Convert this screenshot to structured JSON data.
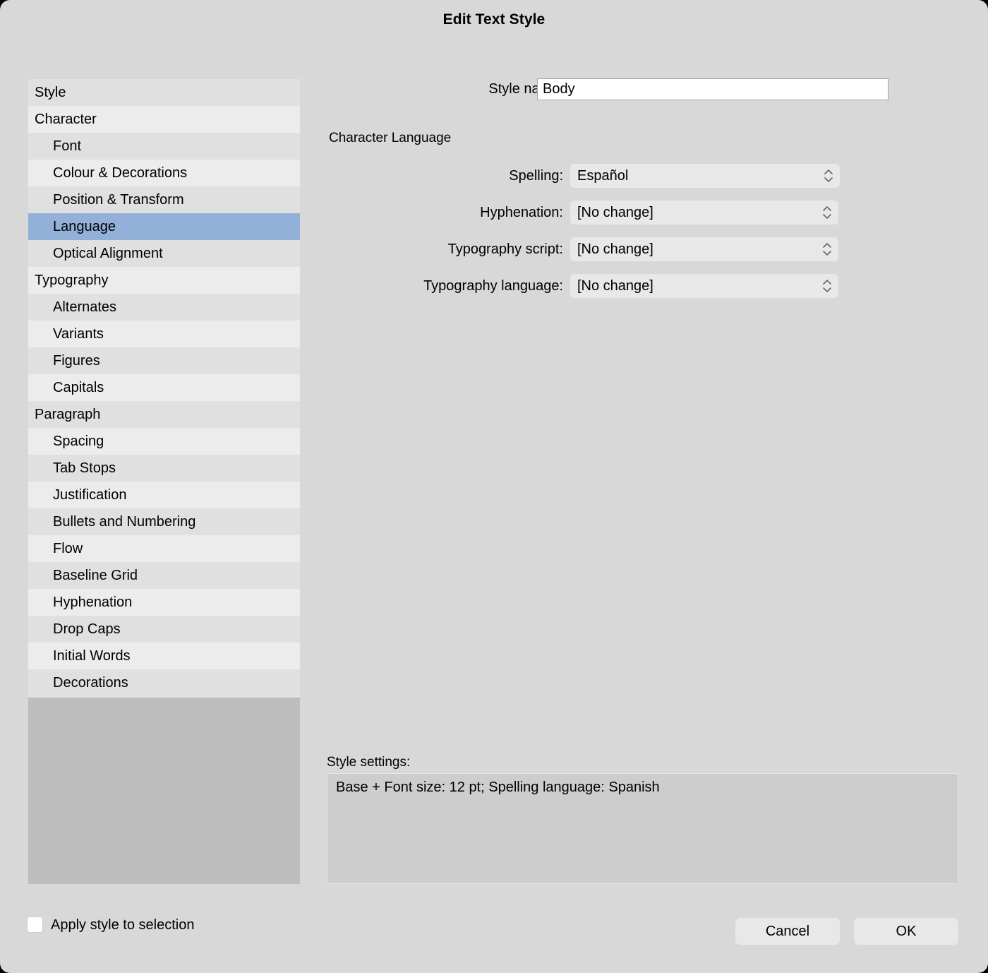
{
  "window": {
    "title": "Edit Text Style",
    "accent_selected": "#93b0d8",
    "background": "#d8d8d8"
  },
  "sidebar": {
    "items": [
      {
        "label": "Style",
        "level": "group",
        "selected": false
      },
      {
        "label": "Character",
        "level": "group",
        "selected": false
      },
      {
        "label": "Font",
        "level": "child",
        "selected": false
      },
      {
        "label": "Colour & Decorations",
        "level": "child",
        "selected": false
      },
      {
        "label": "Position & Transform",
        "level": "child",
        "selected": false
      },
      {
        "label": "Language",
        "level": "child",
        "selected": true
      },
      {
        "label": "Optical Alignment",
        "level": "child",
        "selected": false
      },
      {
        "label": "Typography",
        "level": "group",
        "selected": false
      },
      {
        "label": "Alternates",
        "level": "child",
        "selected": false
      },
      {
        "label": "Variants",
        "level": "child",
        "selected": false
      },
      {
        "label": "Figures",
        "level": "child",
        "selected": false
      },
      {
        "label": "Capitals",
        "level": "child",
        "selected": false
      },
      {
        "label": "Paragraph",
        "level": "group",
        "selected": false
      },
      {
        "label": "Spacing",
        "level": "child",
        "selected": false
      },
      {
        "label": "Tab Stops",
        "level": "child",
        "selected": false
      },
      {
        "label": "Justification",
        "level": "child",
        "selected": false
      },
      {
        "label": "Bullets and Numbering",
        "level": "child",
        "selected": false
      },
      {
        "label": "Flow",
        "level": "child",
        "selected": false
      },
      {
        "label": "Baseline Grid",
        "level": "child",
        "selected": false
      },
      {
        "label": "Hyphenation",
        "level": "child",
        "selected": false
      },
      {
        "label": "Drop Caps",
        "level": "child",
        "selected": false
      },
      {
        "label": "Initial Words",
        "level": "child",
        "selected": false
      },
      {
        "label": "Decorations",
        "level": "child",
        "selected": false
      }
    ]
  },
  "style_name": {
    "label": "Style name:",
    "value": "Body",
    "placeholder": ""
  },
  "character_language": {
    "heading": "Character Language",
    "fields": [
      {
        "label": "Spelling:",
        "value": "Español"
      },
      {
        "label": "Hyphenation:",
        "value": "[No change]"
      },
      {
        "label": "Typography script:",
        "value": "[No change]"
      },
      {
        "label": "Typography language:",
        "value": "[No change]"
      }
    ]
  },
  "style_settings": {
    "label": "Style settings:",
    "text": "Base + Font size: 12 pt; Spelling language: Spanish"
  },
  "footer": {
    "apply_label": "Apply style to selection",
    "apply_checked": false,
    "cancel_label": "Cancel",
    "ok_label": "OK"
  }
}
